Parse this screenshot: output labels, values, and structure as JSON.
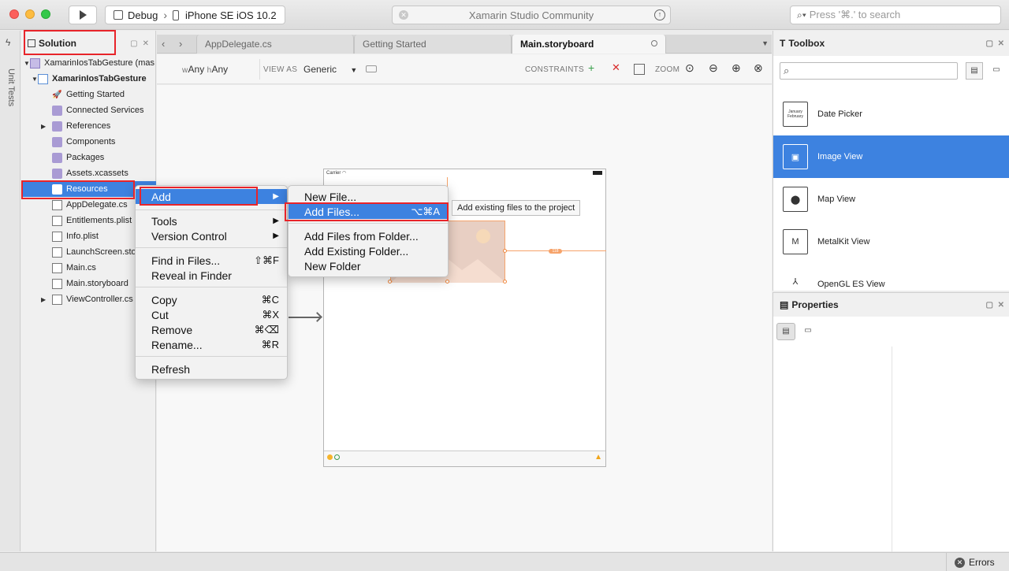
{
  "titlebar": {
    "config": "Debug",
    "device": "iPhone SE iOS 10.2",
    "status": "Xamarin Studio Community",
    "search_placeholder": "Press '⌘.' to search"
  },
  "left_strip": {
    "label": "Unit Tests"
  },
  "solution": {
    "title": "Solution",
    "tree": [
      {
        "label": "XamarinIosTabGesture (mas",
        "icon": "solution-icon"
      },
      {
        "label": "XamarinIosTabGesture",
        "icon": "ios-project-icon"
      },
      {
        "label": "Getting Started",
        "icon": "rocket-icon"
      },
      {
        "label": "Connected Services",
        "icon": "folder-icon"
      },
      {
        "label": "References",
        "icon": "folder-icon"
      },
      {
        "label": "Components",
        "icon": "folder-icon"
      },
      {
        "label": "Packages",
        "icon": "folder-icon"
      },
      {
        "label": "Assets.xcassets",
        "icon": "folder-icon"
      },
      {
        "label": "Resources",
        "icon": "folder-icon"
      },
      {
        "label": "AppDelegate.cs",
        "icon": "csharp-file-icon"
      },
      {
        "label": "Entitlements.plist",
        "icon": "plist-file-icon"
      },
      {
        "label": "Info.plist",
        "icon": "plist-file-icon"
      },
      {
        "label": "LaunchScreen.sto",
        "icon": "storyboard-file-icon"
      },
      {
        "label": "Main.cs",
        "icon": "csharp-file-icon"
      },
      {
        "label": "Main.storyboard",
        "icon": "storyboard-file-icon"
      },
      {
        "label": "ViewController.cs",
        "icon": "csharp-file-icon"
      }
    ]
  },
  "tabs": [
    "AppDelegate.cs",
    "Getting Started",
    "Main.storyboard"
  ],
  "designer": {
    "size_class_w": "w",
    "size_class_w_any": "Any",
    "size_class_h": "h",
    "size_class_h_any": "Any",
    "view_as_label": "VIEW AS",
    "view_as_value": "Generic",
    "constraints_label": "CONSTRAINTS",
    "zoom_label": "ZOOM",
    "carrier": "Carrier",
    "constraint_value": "118"
  },
  "context_menu": {
    "items": [
      {
        "label": "Add",
        "shortcut": "",
        "submenu": true
      },
      {
        "label": "Tools",
        "shortcut": "",
        "submenu": true
      },
      {
        "label": "Version Control",
        "shortcut": "",
        "submenu": true
      },
      {
        "label": "Find in Files...",
        "shortcut": "⇧⌘F"
      },
      {
        "label": "Reveal in Finder",
        "shortcut": ""
      },
      {
        "label": "Copy",
        "shortcut": "⌘C"
      },
      {
        "label": "Cut",
        "shortcut": "⌘X"
      },
      {
        "label": "Remove",
        "shortcut": "⌘⌫"
      },
      {
        "label": "Rename...",
        "shortcut": "⌘R"
      },
      {
        "label": "Refresh",
        "shortcut": ""
      }
    ]
  },
  "add_submenu": {
    "items": [
      {
        "label": "New File...",
        "shortcut": ""
      },
      {
        "label": "Add Files...",
        "shortcut": "⌥⌘A"
      },
      {
        "label": "Add Files from Folder...",
        "shortcut": ""
      },
      {
        "label": "Add Existing Folder...",
        "shortcut": ""
      },
      {
        "label": "New Folder",
        "shortcut": ""
      }
    ]
  },
  "tooltip": "Add existing files to the project",
  "toolbox": {
    "title": "Toolbox",
    "items": [
      {
        "label": "Date Picker",
        "icon": "date-picker-icon",
        "icon_text_1": "January",
        "icon_text_2": "February"
      },
      {
        "label": "Image View",
        "icon": "image-view-icon"
      },
      {
        "label": "Map View",
        "icon": "map-pin-icon"
      },
      {
        "label": "MetalKit View",
        "icon": "metalkit-icon"
      },
      {
        "label": "OpenGL ES View",
        "icon": "opengl-icon"
      }
    ]
  },
  "properties": {
    "title": "Properties"
  },
  "bottombar": {
    "errors": "Errors"
  },
  "colors": {
    "accent": "#3d82e0",
    "highlight": "#e8242a",
    "constraint": "#f6a36a"
  }
}
